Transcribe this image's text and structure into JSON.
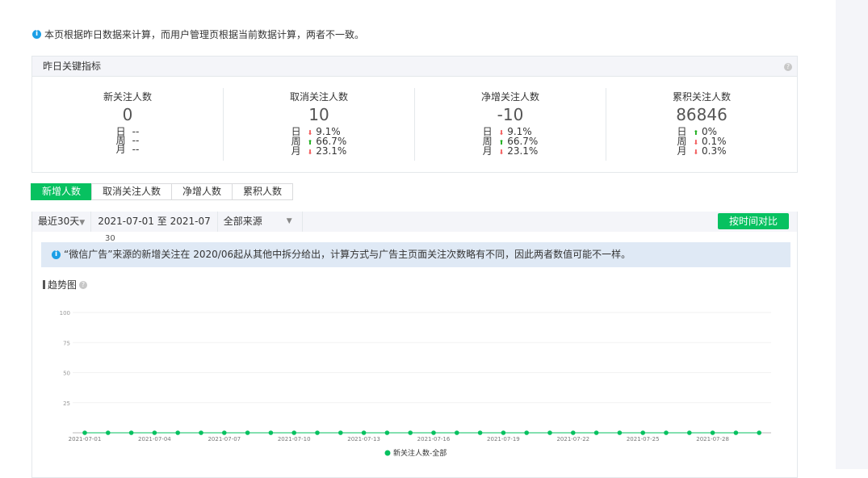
{
  "notice": "本页根据昨日数据来计算，而用户管理页根据当前数据计算，两者不一致。",
  "kpi": {
    "title": "昨日关键指标",
    "row_labels": [
      "日",
      "周",
      "月"
    ],
    "cards": [
      {
        "title": "新关注人数",
        "value": "0",
        "changes": [
          {
            "dir": "none",
            "text": "--"
          },
          {
            "dir": "none",
            "text": "--"
          },
          {
            "dir": "none",
            "text": "--"
          }
        ]
      },
      {
        "title": "取消关注人数",
        "value": "10",
        "changes": [
          {
            "dir": "down",
            "text": "9.1%"
          },
          {
            "dir": "up",
            "text": "66.7%"
          },
          {
            "dir": "down",
            "text": "23.1%"
          }
        ]
      },
      {
        "title": "净增关注人数",
        "value": "-10",
        "changes": [
          {
            "dir": "down",
            "text": "9.1%"
          },
          {
            "dir": "up",
            "text": "66.7%"
          },
          {
            "dir": "down",
            "text": "23.1%"
          }
        ]
      },
      {
        "title": "累积关注人数",
        "value": "86846",
        "changes": [
          {
            "dir": "up",
            "text": "0%"
          },
          {
            "dir": "down",
            "text": "0.1%"
          },
          {
            "dir": "down",
            "text": "0.3%"
          }
        ]
      }
    ]
  },
  "tabs": [
    "新增人数",
    "取消关注人数",
    "净增人数",
    "累积人数"
  ],
  "filter": {
    "range": "最近30天",
    "dates": "2021-07-01 至 2021-07",
    "source": "全部来源",
    "compare": "按时间对比",
    "stray": "30"
  },
  "tip": "“微信广告”来源的新增关注在 2020/06起从其他中拆分给出，计算方式与广告主页面关注次数略有不同，因此两者数值可能不一样。",
  "trend_title": "趋势图",
  "colors": {
    "green": "#07c160",
    "up": "#1aad19",
    "down": "#f25c5c"
  },
  "chart_data": {
    "type": "line",
    "ylim": [
      0,
      100
    ],
    "yticks": [
      25,
      50,
      75,
      100
    ],
    "xtick_labels": [
      "2021-07-01",
      "2021-07-04",
      "2021-07-07",
      "2021-07-10",
      "2021-07-13",
      "2021-07-16",
      "2021-07-19",
      "2021-07-22",
      "2021-07-25",
      "2021-07-28"
    ],
    "x": [
      "07-01",
      "07-02",
      "07-03",
      "07-04",
      "07-05",
      "07-06",
      "07-07",
      "07-08",
      "07-09",
      "07-10",
      "07-11",
      "07-12",
      "07-13",
      "07-14",
      "07-15",
      "07-16",
      "07-17",
      "07-18",
      "07-19",
      "07-20",
      "07-21",
      "07-22",
      "07-23",
      "07-24",
      "07-25",
      "07-26",
      "07-27",
      "07-28",
      "07-29",
      "07-30"
    ],
    "series": [
      {
        "name": "新关注人数-全部",
        "values": [
          0,
          0,
          0,
          0,
          0,
          0,
          0,
          0,
          0,
          0,
          0,
          0,
          0,
          0,
          0,
          0,
          0,
          0,
          0,
          0,
          0,
          0,
          0,
          0,
          0,
          0,
          0,
          0,
          0,
          0
        ]
      }
    ]
  }
}
